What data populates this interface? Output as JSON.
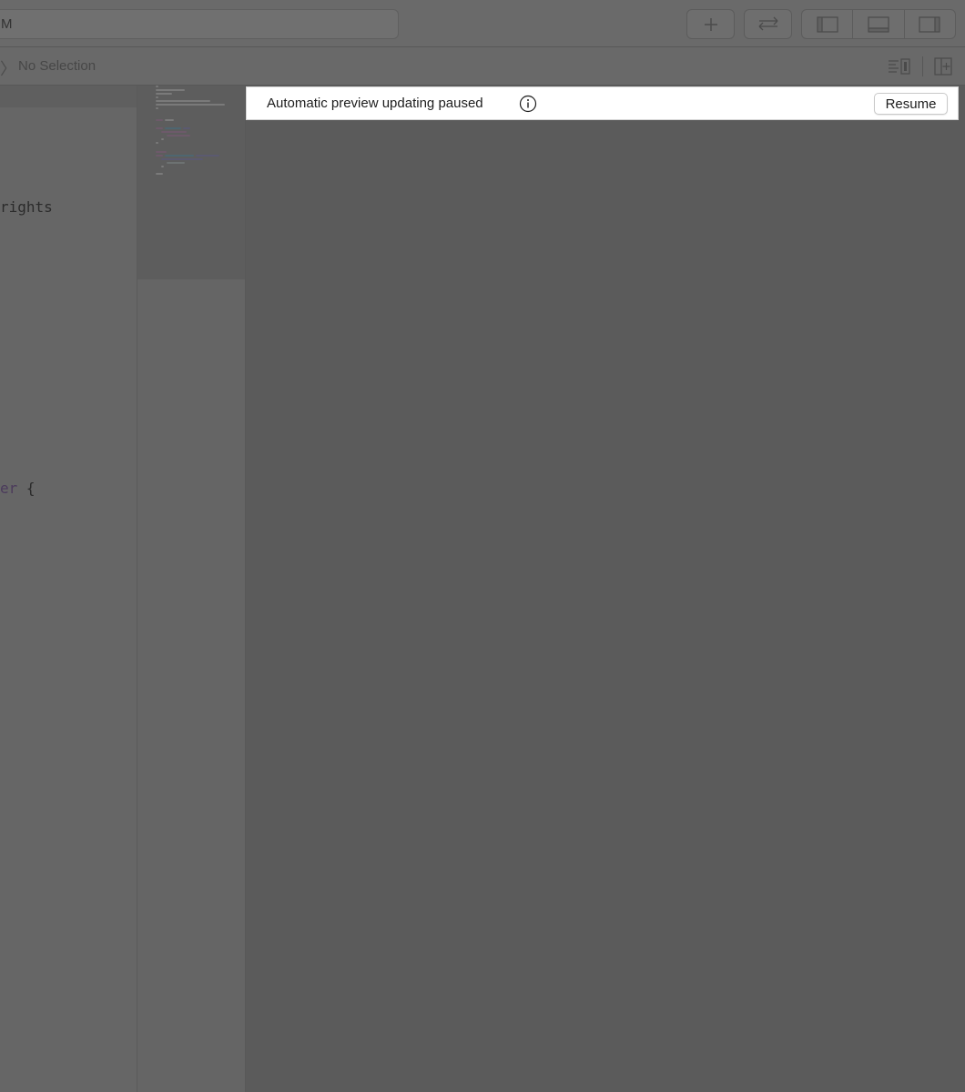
{
  "toolbar": {
    "activity_text": "M",
    "add_button_icon": "plus-icon",
    "code_review_button_icon": "swap-arrows-icon",
    "navigator_toggle_icon": "left-panel-icon",
    "debug_area_toggle_icon": "bottom-panel-icon",
    "inspector_toggle_icon": "right-panel-icon"
  },
  "jumpbar": {
    "chevron": "〉",
    "selection_text": "No Selection",
    "editor_options_icon": "lines-and-canvas-icon",
    "add_editor_icon": "split-add-icon"
  },
  "editor": {
    "visible_fragments": [
      {
        "text": "rights"
      },
      {
        "text_colored": "er",
        "text_plain": " {"
      }
    ]
  },
  "preview": {
    "banner_message": "Automatic preview updating paused",
    "banner_info_icon": "info-circle-icon",
    "resume_label": "Resume"
  },
  "colors": {
    "dimmed_background": "#5b5b5b",
    "banner_background": "#ffffff",
    "keyword_purple": "#4b3a5c"
  }
}
